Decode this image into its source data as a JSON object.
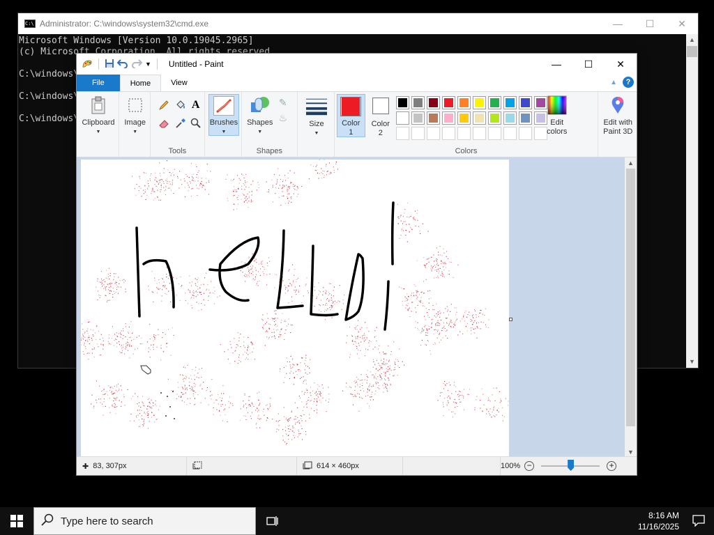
{
  "cmd": {
    "title": "Administrator: C:\\windows\\system32\\cmd.exe",
    "lines": [
      "Microsoft Windows [Version 10.0.19045.2965]",
      "(c) Microsoft Corporation. All rights reserved.",
      "",
      "C:\\windows\\system32>",
      "",
      "C:\\windows\\system32>",
      "",
      "C:\\windows\\system32>"
    ]
  },
  "paint": {
    "title": "Untitled - Paint",
    "tabs": {
      "file": "File",
      "home": "Home",
      "view": "View"
    },
    "ribbon": {
      "clipboard": "Clipboard",
      "image": "Image",
      "tools": "Tools",
      "brushes": "Brushes",
      "shapes_btn": "Shapes",
      "shapes_group": "Shapes",
      "size": "Size",
      "color1_line1": "Color",
      "color1_line2": "1",
      "color2_line1": "Color",
      "color2_line2": "2",
      "colors_group": "Colors",
      "edit_colors_line1": "Edit",
      "edit_colors_line2": "colors",
      "paint3d_line1": "Edit with",
      "paint3d_line2": "Paint 3D"
    },
    "color1": "#ed1c24",
    "color2": "#ffffff",
    "palette_row1": [
      "#000000",
      "#7f7f7f",
      "#880015",
      "#ed1c24",
      "#ff7f27",
      "#fff200",
      "#22b14c",
      "#00a2e8",
      "#3f48cc",
      "#a349a4"
    ],
    "palette_row2": [
      "#ffffff",
      "#c3c3c3",
      "#b97a57",
      "#ffaec9",
      "#ffc90e",
      "#efe4b0",
      "#b5e61d",
      "#99d9ea",
      "#7092be",
      "#c8bfe7"
    ],
    "canvas_text": "hello!",
    "status": {
      "cursor_pos": "83, 307px",
      "selection_size": "",
      "image_size": "614 × 460px",
      "zoom": "100%"
    }
  },
  "taskbar": {
    "search_placeholder": "Type here to search",
    "time": "8:16 AM",
    "date": "11/16/2025"
  }
}
